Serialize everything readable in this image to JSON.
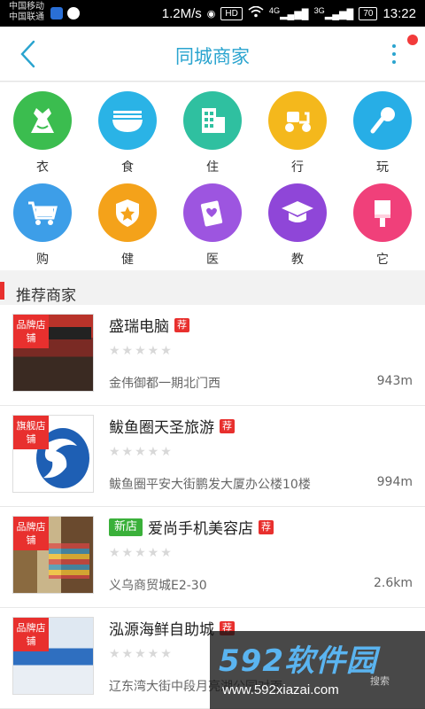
{
  "status_bar": {
    "carrier1": "中国移动",
    "carrier2": "中国联通",
    "speed": "1.2M/s",
    "hd": "HD",
    "net1": "4G",
    "net2": "3G",
    "battery": "70",
    "time": "13:22"
  },
  "header": {
    "title": "同城商家"
  },
  "categories": [
    {
      "label": "衣",
      "color": "#3bbd4f",
      "icon": "dress-icon"
    },
    {
      "label": "食",
      "color": "#2ab3e6",
      "icon": "bowl-icon"
    },
    {
      "label": "住",
      "color": "#2fc0a0",
      "icon": "building-icon"
    },
    {
      "label": "行",
      "color": "#f4b81c",
      "icon": "scooter-icon"
    },
    {
      "label": "玩",
      "color": "#27aee6",
      "icon": "microphone-icon"
    },
    {
      "label": "购",
      "color": "#3d9ee8",
      "icon": "cart-icon"
    },
    {
      "label": "健",
      "color": "#f4a21a",
      "icon": "shield-star-icon"
    },
    {
      "label": "医",
      "color": "#9d55e0",
      "icon": "heart-card-icon"
    },
    {
      "label": "教",
      "color": "#8f46d8",
      "icon": "graduation-cap-icon"
    },
    {
      "label": "它",
      "color": "#f0407a",
      "icon": "brush-icon"
    }
  ],
  "section": {
    "title": "推荐商家"
  },
  "stores": [
    {
      "name": "盛瑞电脑",
      "badge": "荐",
      "new_tag": "",
      "ribbon": "品牌店铺",
      "rating": "★★★★★",
      "address": "金伟御都一期北门西",
      "distance": "943m"
    },
    {
      "name": "鲅鱼圈天圣旅游",
      "badge": "荐",
      "new_tag": "",
      "ribbon": "旗舰店铺",
      "rating": "★★★★★",
      "address": "鲅鱼圈平安大街鹏发大厦办公楼10楼",
      "distance": "994m"
    },
    {
      "name": "爱尚手机美容店",
      "badge": "荐",
      "new_tag": "新店",
      "ribbon": "品牌店铺",
      "rating": "★★★★★",
      "address": "义乌商贸城E2-30",
      "distance": "2.6km"
    },
    {
      "name": "泓源海鲜自助城",
      "badge": "荐",
      "new_tag": "",
      "ribbon": "品牌店铺",
      "rating": "★★★★★",
      "address": "辽东湾大街中段月亮湖公园对面",
      "distance": ""
    }
  ],
  "watermark": {
    "logo": "592软件园",
    "url": "www.592xiazai.com",
    "search": "搜索"
  }
}
